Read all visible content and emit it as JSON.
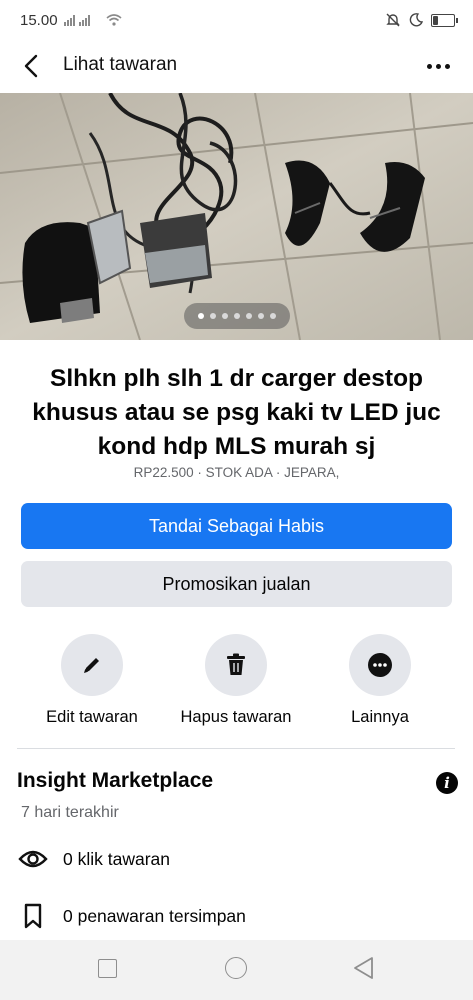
{
  "status_bar": {
    "time": "15.00"
  },
  "header": {
    "title": "Lihat tawaran",
    "back_icon": "chevron-left-icon",
    "more_icon": "more-horizontal-icon"
  },
  "photo": {
    "total_images": 7,
    "current_index": 1
  },
  "listing": {
    "title": "Slhkn plh slh 1 dr carger destop khusus atau se psg kaki tv LED juc kond hdp MLS murah sj",
    "meta": "RP22.500 · STOK ADA · JEPARA,"
  },
  "buttons": {
    "mark_sold": "Tandai Sebagai Habis",
    "promote": "Promosikan jualan"
  },
  "actions": [
    {
      "label": "Edit tawaran",
      "icon": "pencil-icon"
    },
    {
      "label": "Hapus tawaran",
      "icon": "trash-icon"
    },
    {
      "label": "Lainnya",
      "icon": "more-circle-icon"
    }
  ],
  "insights": {
    "title": "Insight Marketplace",
    "subtitle": "7 hari terakhir",
    "stats": [
      {
        "text": "0 klik tawaran",
        "icon": "eye-icon"
      },
      {
        "text": "0 penawaran tersimpan",
        "icon": "bookmark-icon"
      }
    ]
  },
  "colors": {
    "primary": "#1877f2",
    "secondary_bg": "#e4e6eb",
    "muted_text": "#65676b"
  }
}
